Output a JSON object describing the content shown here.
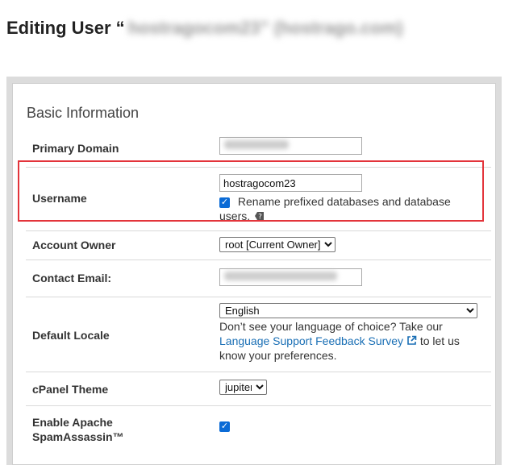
{
  "header": {
    "title": "Editing User “",
    "title_redacted": "hostragocom23” (hostrago.com)"
  },
  "section": {
    "title": "Basic Information"
  },
  "fields": {
    "primary_domain": {
      "label": "Primary Domain"
    },
    "username": {
      "label": "Username",
      "value": "hostragocom23",
      "rename_checked": true,
      "rename_label_line1": "Rename prefixed databases and database",
      "rename_label_line2": "users."
    },
    "account_owner": {
      "label": "Account Owner",
      "selected": "root [Current Owner]"
    },
    "contact_email": {
      "label": "Contact Email:"
    },
    "default_locale": {
      "label": "Default Locale",
      "selected": "English",
      "help_line1": "Don’t see your language of choice? Take our",
      "help_link": "Language Support Feedback Survey",
      "help_after_link": "to let us",
      "help_line3": "know your preferences."
    },
    "cpanel_theme": {
      "label": "cPanel Theme",
      "selected": "jupiter"
    },
    "spamassassin": {
      "label_line1": "Enable Apache",
      "label_line2": "SpamAssassin™",
      "checked": true
    }
  },
  "colors": {
    "highlight": "#e3343b",
    "link": "#1a6fb5",
    "checkbox": "#0b6bd6"
  },
  "icons": {
    "help": "help-icon",
    "external_link": "external-link-icon"
  }
}
